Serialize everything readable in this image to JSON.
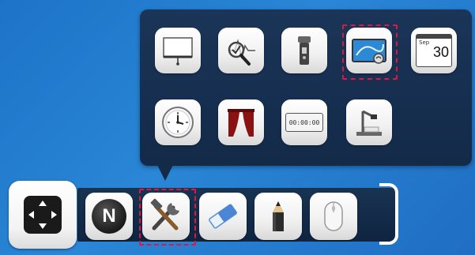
{
  "popup": {
    "items": [
      {
        "name": "whiteboard",
        "icon": "whiteboard-icon"
      },
      {
        "name": "signal-analysis",
        "icon": "magnifier-signal-icon"
      },
      {
        "name": "flashlight",
        "icon": "flashlight-icon"
      },
      {
        "name": "screen-capture",
        "icon": "screen-draw-icon",
        "selected": true
      },
      {
        "name": "calendar",
        "icon": "calendar-icon",
        "month": "Sep",
        "day": "30"
      },
      {
        "name": "clock",
        "icon": "clock-icon"
      },
      {
        "name": "curtain",
        "icon": "curtain-icon"
      },
      {
        "name": "timer",
        "icon": "timer-display-icon",
        "display": "00:00:00"
      },
      {
        "name": "document-camera",
        "icon": "document-camera-icon"
      }
    ]
  },
  "toolbar": {
    "nav_icon": "move-arrows-icon",
    "items": [
      {
        "name": "note",
        "icon": "note-n-icon",
        "letter": "N"
      },
      {
        "name": "tools",
        "icon": "tools-icon",
        "selected": true
      },
      {
        "name": "eraser",
        "icon": "eraser-icon"
      },
      {
        "name": "pencil",
        "icon": "pencil-icon"
      },
      {
        "name": "mouse",
        "icon": "mouse-icon"
      }
    ]
  },
  "colors": {
    "selection": "#e1163c",
    "panel": "#132a49",
    "background": "#2a86d6"
  }
}
